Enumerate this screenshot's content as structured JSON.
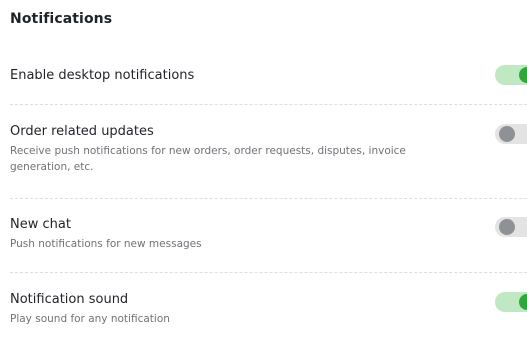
{
  "section": {
    "title": "Notifications"
  },
  "settings": [
    {
      "title": "Enable desktop notifications",
      "description": "",
      "enabled": true
    },
    {
      "title": "Order related updates",
      "description": "Receive push notifications for new orders, order requests, disputes, invoice generation, etc.",
      "enabled": false
    },
    {
      "title": "New chat",
      "description": "Push notifications for new messages",
      "enabled": false
    },
    {
      "title": "Notification sound",
      "description": "Play sound for any notification",
      "enabled": true
    }
  ],
  "colors": {
    "toggle_on_track": "#bfe8c3",
    "toggle_on_knob": "#31a63a",
    "toggle_off_track": "#e3e3e3",
    "toggle_off_knob": "#8e9196"
  }
}
